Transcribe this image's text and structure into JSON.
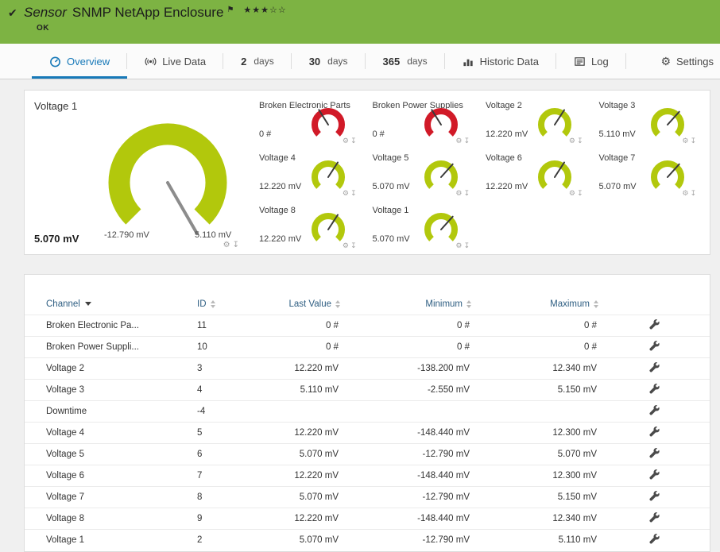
{
  "colors": {
    "brand_green": "#7db343",
    "accent_blue": "#1779b8",
    "gauge_green": "#b2c80c",
    "gauge_red": "#d11a28"
  },
  "icons": {
    "gear": "⚙",
    "download": "↧"
  },
  "header": {
    "check_icon": "✔",
    "type_label": "Sensor",
    "title": "SNMP NetApp Enclosure",
    "flag_icon": "⚑",
    "stars": "★★★☆☆",
    "status": "OK"
  },
  "tabs": {
    "overview": "Overview",
    "live_data": "Live Data",
    "d2_num": "2",
    "d2_label": "days",
    "d30_num": "30",
    "d30_label": "days",
    "d365_num": "365",
    "d365_label": "days",
    "historic": "Historic Data",
    "log": "Log",
    "settings": "Settings"
  },
  "main_gauge": {
    "title": "Voltage 1",
    "value": "5.070 mV",
    "min": "-12.790 mV",
    "max": "5.110 mV",
    "color": "#b2c80c",
    "needle_deg": 150
  },
  "small_gauges": [
    {
      "label": "Broken Electronic Parts",
      "value": "0 #",
      "color": "#d11a28",
      "needle_deg": -32
    },
    {
      "label": "Broken Power Supplies",
      "value": "0 #",
      "color": "#d11a28",
      "needle_deg": -32
    },
    {
      "label": "Voltage 2",
      "value": "12.220 mV",
      "color": "#b2c80c",
      "needle_deg": 33
    },
    {
      "label": "Voltage 3",
      "value": "5.110 mV",
      "color": "#b2c80c",
      "needle_deg": 42
    },
    {
      "label": "Voltage 4",
      "value": "12.220 mV",
      "color": "#b2c80c",
      "needle_deg": 33
    },
    {
      "label": "Voltage 5",
      "value": "5.070 mV",
      "color": "#b2c80c",
      "needle_deg": 42
    },
    {
      "label": "Voltage 6",
      "value": "12.220 mV",
      "color": "#b2c80c",
      "needle_deg": 33
    },
    {
      "label": "Voltage 7",
      "value": "5.070 mV",
      "color": "#b2c80c",
      "needle_deg": 42
    },
    {
      "label": "Voltage 8",
      "value": "12.220 mV",
      "color": "#b2c80c",
      "needle_deg": 33
    },
    {
      "label": "Voltage 1",
      "value": "5.070 mV",
      "color": "#b2c80c",
      "needle_deg": 42
    }
  ],
  "table": {
    "headers": {
      "channel": "Channel",
      "id": "ID",
      "last_value": "Last Value",
      "minimum": "Minimum",
      "maximum": "Maximum"
    },
    "rows": [
      {
        "channel": "Broken Electronic Pa...",
        "id": "11",
        "last": "0 #",
        "min": "0 #",
        "max": "0 #"
      },
      {
        "channel": "Broken Power Suppli...",
        "id": "10",
        "last": "0 #",
        "min": "0 #",
        "max": "0 #"
      },
      {
        "channel": "Voltage 2",
        "id": "3",
        "last": "12.220 mV",
        "min": "-138.200 mV",
        "max": "12.340 mV"
      },
      {
        "channel": "Voltage 3",
        "id": "4",
        "last": "5.110 mV",
        "min": "-2.550 mV",
        "max": "5.150 mV"
      },
      {
        "channel": "Downtime",
        "id": "-4",
        "last": "",
        "min": "",
        "max": ""
      },
      {
        "channel": "Voltage 4",
        "id": "5",
        "last": "12.220 mV",
        "min": "-148.440 mV",
        "max": "12.300 mV"
      },
      {
        "channel": "Voltage 5",
        "id": "6",
        "last": "5.070 mV",
        "min": "-12.790 mV",
        "max": "5.070 mV"
      },
      {
        "channel": "Voltage 6",
        "id": "7",
        "last": "12.220 mV",
        "min": "-148.440 mV",
        "max": "12.300 mV"
      },
      {
        "channel": "Voltage 7",
        "id": "8",
        "last": "5.070 mV",
        "min": "-12.790 mV",
        "max": "5.150 mV"
      },
      {
        "channel": "Voltage 8",
        "id": "9",
        "last": "12.220 mV",
        "min": "-148.440 mV",
        "max": "12.340 mV"
      },
      {
        "channel": "Voltage 1",
        "id": "2",
        "last": "5.070 mV",
        "min": "-12.790 mV",
        "max": "5.110 mV"
      }
    ]
  }
}
